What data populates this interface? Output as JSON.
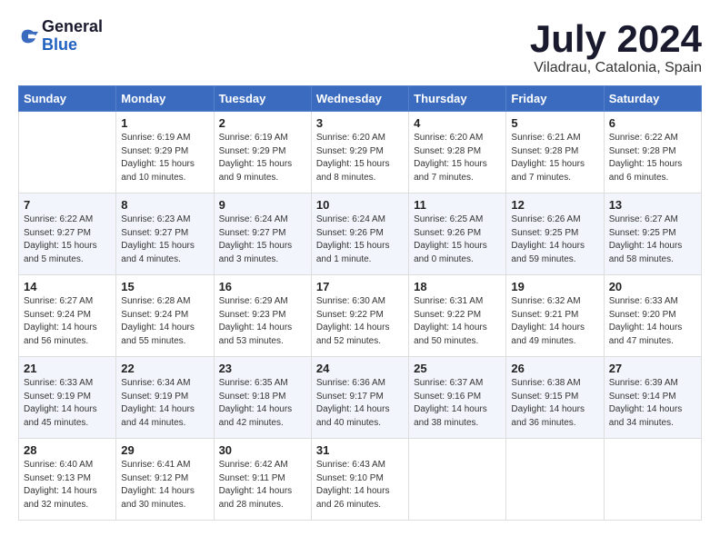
{
  "logo": {
    "general": "General",
    "blue": "Blue"
  },
  "title": "July 2024",
  "location": "Viladrau, Catalonia, Spain",
  "days_header": [
    "Sunday",
    "Monday",
    "Tuesday",
    "Wednesday",
    "Thursday",
    "Friday",
    "Saturday"
  ],
  "weeks": [
    [
      {
        "day": "",
        "sunrise": "",
        "sunset": "",
        "daylight": ""
      },
      {
        "day": "1",
        "sunrise": "Sunrise: 6:19 AM",
        "sunset": "Sunset: 9:29 PM",
        "daylight": "Daylight: 15 hours and 10 minutes."
      },
      {
        "day": "2",
        "sunrise": "Sunrise: 6:19 AM",
        "sunset": "Sunset: 9:29 PM",
        "daylight": "Daylight: 15 hours and 9 minutes."
      },
      {
        "day": "3",
        "sunrise": "Sunrise: 6:20 AM",
        "sunset": "Sunset: 9:29 PM",
        "daylight": "Daylight: 15 hours and 8 minutes."
      },
      {
        "day": "4",
        "sunrise": "Sunrise: 6:20 AM",
        "sunset": "Sunset: 9:28 PM",
        "daylight": "Daylight: 15 hours and 7 minutes."
      },
      {
        "day": "5",
        "sunrise": "Sunrise: 6:21 AM",
        "sunset": "Sunset: 9:28 PM",
        "daylight": "Daylight: 15 hours and 7 minutes."
      },
      {
        "day": "6",
        "sunrise": "Sunrise: 6:22 AM",
        "sunset": "Sunset: 9:28 PM",
        "daylight": "Daylight: 15 hours and 6 minutes."
      }
    ],
    [
      {
        "day": "7",
        "sunrise": "Sunrise: 6:22 AM",
        "sunset": "Sunset: 9:27 PM",
        "daylight": "Daylight: 15 hours and 5 minutes."
      },
      {
        "day": "8",
        "sunrise": "Sunrise: 6:23 AM",
        "sunset": "Sunset: 9:27 PM",
        "daylight": "Daylight: 15 hours and 4 minutes."
      },
      {
        "day": "9",
        "sunrise": "Sunrise: 6:24 AM",
        "sunset": "Sunset: 9:27 PM",
        "daylight": "Daylight: 15 hours and 3 minutes."
      },
      {
        "day": "10",
        "sunrise": "Sunrise: 6:24 AM",
        "sunset": "Sunset: 9:26 PM",
        "daylight": "Daylight: 15 hours and 1 minute."
      },
      {
        "day": "11",
        "sunrise": "Sunrise: 6:25 AM",
        "sunset": "Sunset: 9:26 PM",
        "daylight": "Daylight: 15 hours and 0 minutes."
      },
      {
        "day": "12",
        "sunrise": "Sunrise: 6:26 AM",
        "sunset": "Sunset: 9:25 PM",
        "daylight": "Daylight: 14 hours and 59 minutes."
      },
      {
        "day": "13",
        "sunrise": "Sunrise: 6:27 AM",
        "sunset": "Sunset: 9:25 PM",
        "daylight": "Daylight: 14 hours and 58 minutes."
      }
    ],
    [
      {
        "day": "14",
        "sunrise": "Sunrise: 6:27 AM",
        "sunset": "Sunset: 9:24 PM",
        "daylight": "Daylight: 14 hours and 56 minutes."
      },
      {
        "day": "15",
        "sunrise": "Sunrise: 6:28 AM",
        "sunset": "Sunset: 9:24 PM",
        "daylight": "Daylight: 14 hours and 55 minutes."
      },
      {
        "day": "16",
        "sunrise": "Sunrise: 6:29 AM",
        "sunset": "Sunset: 9:23 PM",
        "daylight": "Daylight: 14 hours and 53 minutes."
      },
      {
        "day": "17",
        "sunrise": "Sunrise: 6:30 AM",
        "sunset": "Sunset: 9:22 PM",
        "daylight": "Daylight: 14 hours and 52 minutes."
      },
      {
        "day": "18",
        "sunrise": "Sunrise: 6:31 AM",
        "sunset": "Sunset: 9:22 PM",
        "daylight": "Daylight: 14 hours and 50 minutes."
      },
      {
        "day": "19",
        "sunrise": "Sunrise: 6:32 AM",
        "sunset": "Sunset: 9:21 PM",
        "daylight": "Daylight: 14 hours and 49 minutes."
      },
      {
        "day": "20",
        "sunrise": "Sunrise: 6:33 AM",
        "sunset": "Sunset: 9:20 PM",
        "daylight": "Daylight: 14 hours and 47 minutes."
      }
    ],
    [
      {
        "day": "21",
        "sunrise": "Sunrise: 6:33 AM",
        "sunset": "Sunset: 9:19 PM",
        "daylight": "Daylight: 14 hours and 45 minutes."
      },
      {
        "day": "22",
        "sunrise": "Sunrise: 6:34 AM",
        "sunset": "Sunset: 9:19 PM",
        "daylight": "Daylight: 14 hours and 44 minutes."
      },
      {
        "day": "23",
        "sunrise": "Sunrise: 6:35 AM",
        "sunset": "Sunset: 9:18 PM",
        "daylight": "Daylight: 14 hours and 42 minutes."
      },
      {
        "day": "24",
        "sunrise": "Sunrise: 6:36 AM",
        "sunset": "Sunset: 9:17 PM",
        "daylight": "Daylight: 14 hours and 40 minutes."
      },
      {
        "day": "25",
        "sunrise": "Sunrise: 6:37 AM",
        "sunset": "Sunset: 9:16 PM",
        "daylight": "Daylight: 14 hours and 38 minutes."
      },
      {
        "day": "26",
        "sunrise": "Sunrise: 6:38 AM",
        "sunset": "Sunset: 9:15 PM",
        "daylight": "Daylight: 14 hours and 36 minutes."
      },
      {
        "day": "27",
        "sunrise": "Sunrise: 6:39 AM",
        "sunset": "Sunset: 9:14 PM",
        "daylight": "Daylight: 14 hours and 34 minutes."
      }
    ],
    [
      {
        "day": "28",
        "sunrise": "Sunrise: 6:40 AM",
        "sunset": "Sunset: 9:13 PM",
        "daylight": "Daylight: 14 hours and 32 minutes."
      },
      {
        "day": "29",
        "sunrise": "Sunrise: 6:41 AM",
        "sunset": "Sunset: 9:12 PM",
        "daylight": "Daylight: 14 hours and 30 minutes."
      },
      {
        "day": "30",
        "sunrise": "Sunrise: 6:42 AM",
        "sunset": "Sunset: 9:11 PM",
        "daylight": "Daylight: 14 hours and 28 minutes."
      },
      {
        "day": "31",
        "sunrise": "Sunrise: 6:43 AM",
        "sunset": "Sunset: 9:10 PM",
        "daylight": "Daylight: 14 hours and 26 minutes."
      },
      {
        "day": "",
        "sunrise": "",
        "sunset": "",
        "daylight": ""
      },
      {
        "day": "",
        "sunrise": "",
        "sunset": "",
        "daylight": ""
      },
      {
        "day": "",
        "sunrise": "",
        "sunset": "",
        "daylight": ""
      }
    ]
  ]
}
